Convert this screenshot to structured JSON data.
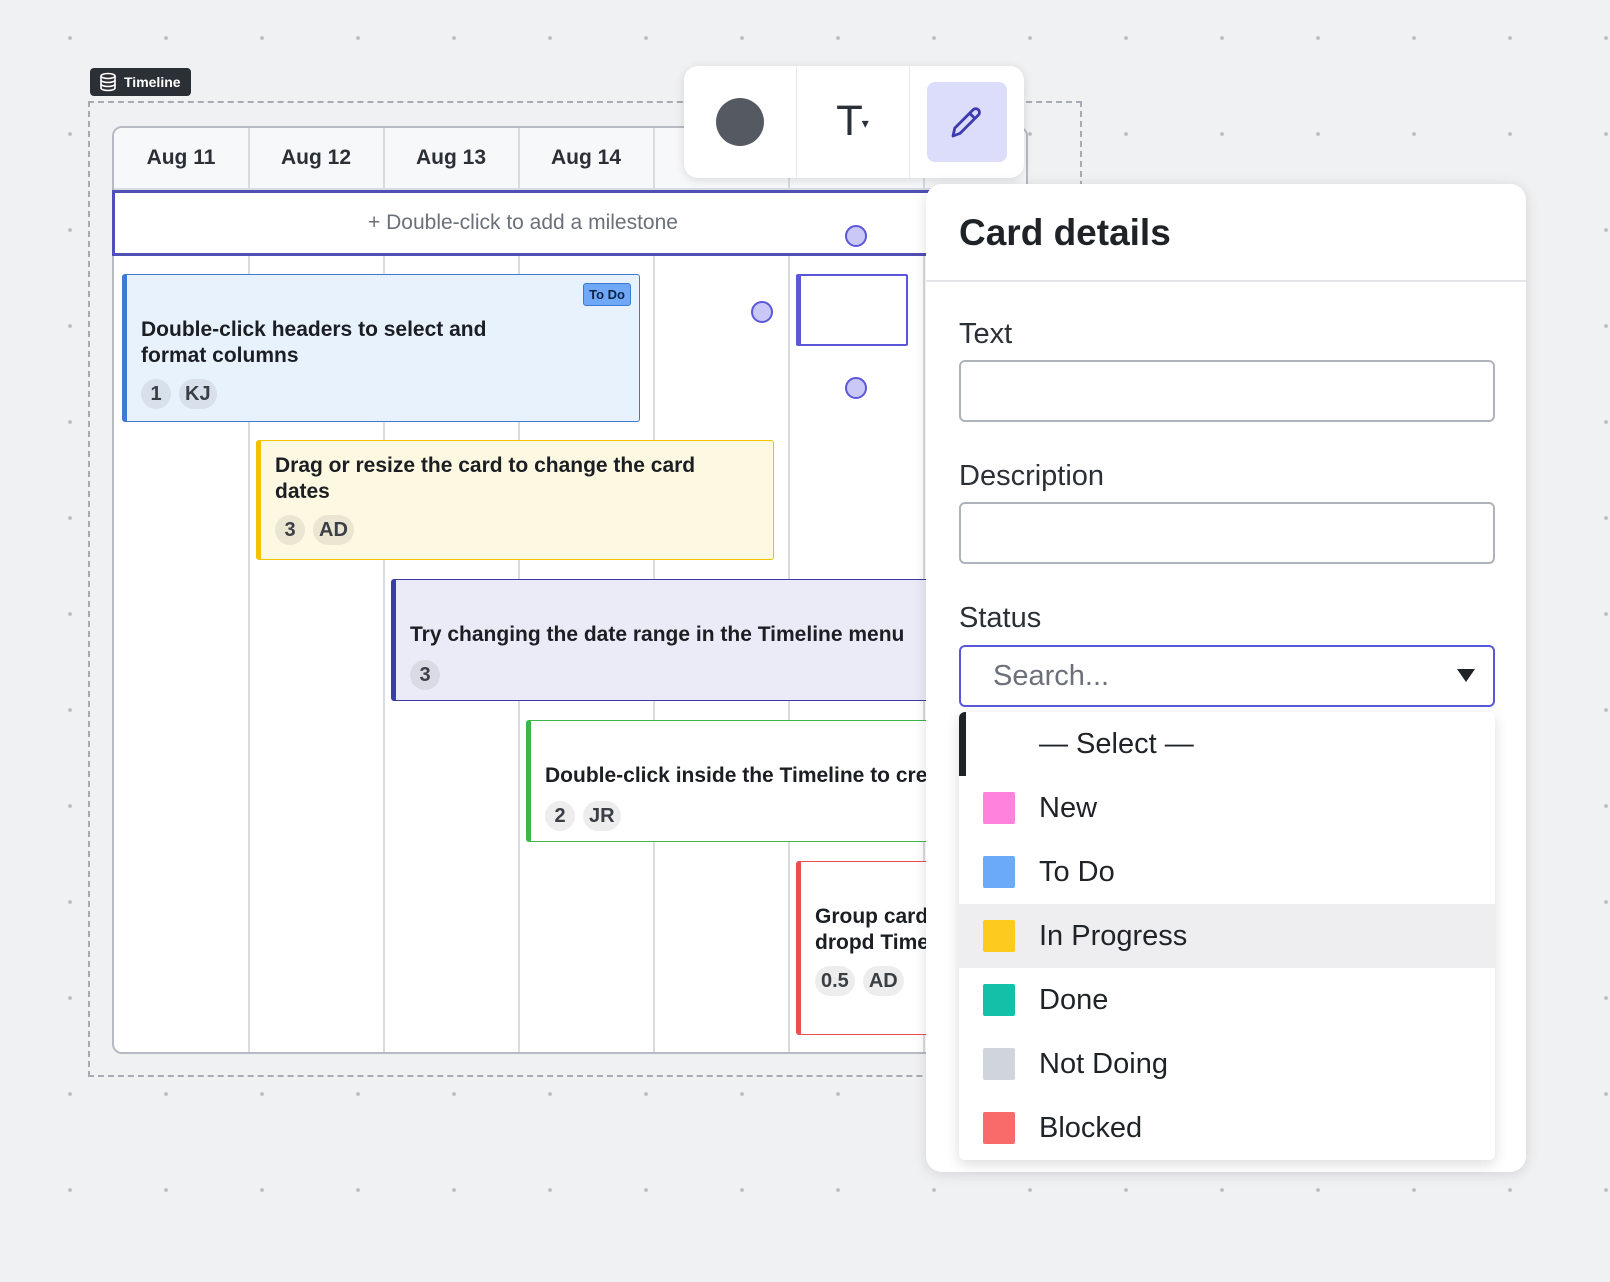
{
  "frame": {
    "tag_label": "Timeline"
  },
  "timeline": {
    "days": [
      "Aug 11",
      "Aug 12",
      "Aug 13",
      "Aug 14"
    ],
    "milestone_hint": "+ Double-click to add a milestone"
  },
  "cards": [
    {
      "title": "Double-click headers to select and format columns",
      "chips": [
        "1",
        "KJ"
      ],
      "status_badge": "To Do",
      "color": "#3d7ad1",
      "bg": "#e8f2fd"
    },
    {
      "title": "Drag or resize the card to change the card dates",
      "chips": [
        "3",
        "AD"
      ],
      "color": "#f2c200",
      "bg": "#fdf8e2"
    },
    {
      "title": "Try changing the date range in the Timeline menu",
      "chips": [
        "3"
      ],
      "color": "#3c3ca6",
      "bg": "#ebebf7"
    },
    {
      "title": "Double-click inside the Timeline to cre",
      "chips": [
        "2",
        "JR"
      ],
      "color": "#3fb44a",
      "bg": "#ffffff"
    },
    {
      "title": "Group card pivot dropd Timeline me",
      "chips": [
        "0.5",
        "AD"
      ],
      "color": "#e84f4f",
      "bg": "#ffffff"
    }
  ],
  "toolbar": {
    "tools": [
      "fill-color",
      "text-format",
      "edit"
    ]
  },
  "panel": {
    "title": "Card details",
    "text_label": "Text",
    "text_value": "",
    "description_label": "Description",
    "description_value": "",
    "status_label": "Status",
    "status_placeholder": "Search...",
    "options": [
      {
        "label": "— Select —",
        "color": ""
      },
      {
        "label": "New",
        "color": "#ff82dc"
      },
      {
        "label": "To Do",
        "color": "#6aaaf8"
      },
      {
        "label": "In Progress",
        "color": "#fccb1e"
      },
      {
        "label": "Done",
        "color": "#14c0a8"
      },
      {
        "label": "Not Doing",
        "color": "#d0d4db"
      },
      {
        "label": "Blocked",
        "color": "#f96a6a"
      }
    ],
    "highlighted_option": "In Progress"
  }
}
